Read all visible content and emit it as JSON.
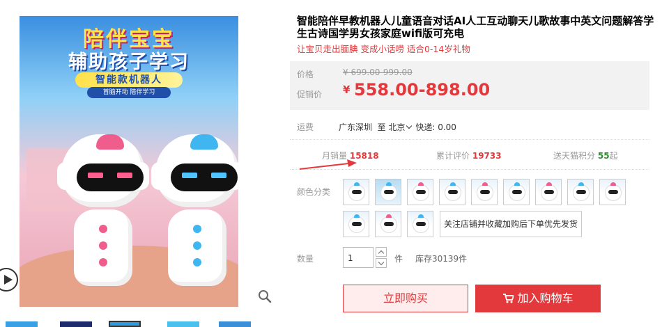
{
  "gallery": {
    "promo_title1": "陪伴宝宝",
    "promo_title2": "辅助孩子学习",
    "promo_sub": "智能款机器人",
    "promo_tags": "首脑开动  陪伴学习"
  },
  "product": {
    "title": "智能陪伴早教机器人儿童语音对话AI人工互动聊天儿歌故事中英文问题解答学生古诗国学男女孩家庭wifi版可充电",
    "subtitle": "让宝贝走出腼腆 变成小话唠 适合0-14岁礼物"
  },
  "price": {
    "original_label": "价格",
    "original_value": "¥ 699.00-999.00",
    "promo_label": "促销价",
    "currency": "¥",
    "promo_value": "558.00-898.00"
  },
  "shipping": {
    "label": "运费",
    "from": "广东深圳",
    "to_word": "至",
    "to_city": "北京",
    "express": "快递: 0.00"
  },
  "stats": {
    "monthly_sales_label": "月销量",
    "monthly_sales": "15818",
    "reviews_label": "累计评价",
    "reviews": "19733",
    "points_prefix": "送天猫积分",
    "points": "55",
    "points_suffix": "起"
  },
  "colors": {
    "label": "颜色分类",
    "swatches": [
      "blue",
      "dark",
      "pink",
      "blue",
      "pink",
      "blue",
      "pink",
      "blue",
      "pink",
      "blue",
      "pink",
      "blue"
    ],
    "follow_text": "关注店铺并收藏加购后下单优先发货"
  },
  "quantity": {
    "label": "数量",
    "value": "1",
    "unit": "件",
    "stock": "库存30139件"
  },
  "actions": {
    "buy_now": "立即购买",
    "add_cart": "加入购物车"
  },
  "theme": {
    "accent": "#e4393c",
    "points_color": "#2f8b2f"
  }
}
